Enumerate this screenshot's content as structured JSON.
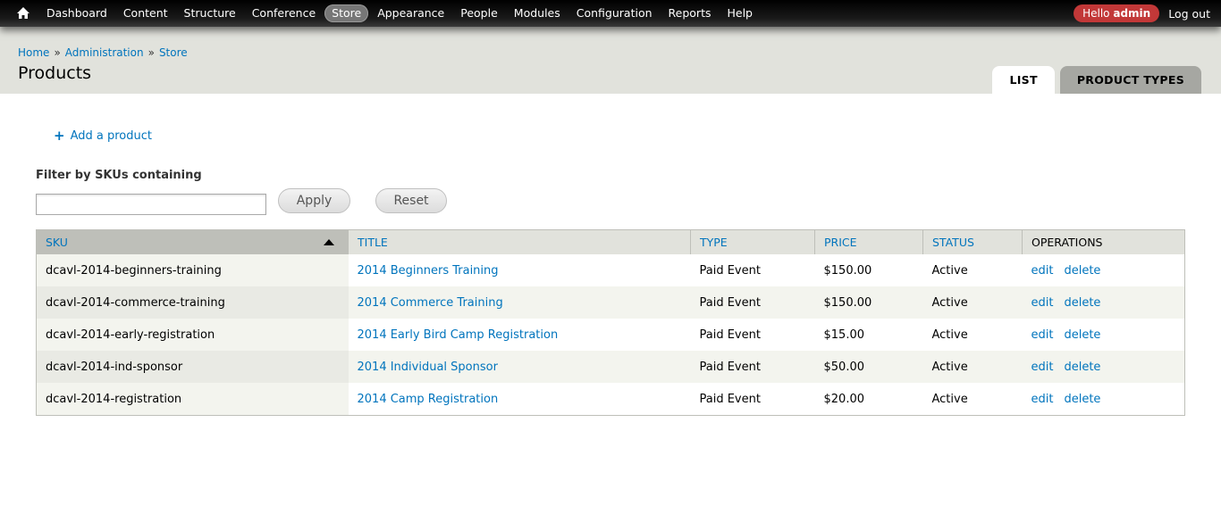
{
  "toolbar": {
    "menu": [
      "Dashboard",
      "Content",
      "Structure",
      "Conference",
      "Store",
      "Appearance",
      "People",
      "Modules",
      "Configuration",
      "Reports",
      "Help"
    ],
    "active_item": "Store",
    "hello_prefix": "Hello",
    "username": "admin",
    "logout": "Log out"
  },
  "breadcrumb": [
    "Home",
    "Administration",
    "Store"
  ],
  "breadcrumb_separator": "»",
  "page_title": "Products",
  "tabs": [
    {
      "label": "LIST",
      "active": true
    },
    {
      "label": "PRODUCT TYPES",
      "active": false
    }
  ],
  "actions": {
    "add_product_icon": "+",
    "add_product": "Add a product"
  },
  "filter": {
    "label": "Filter by SKUs containing",
    "value": "",
    "apply_label": "Apply",
    "reset_label": "Reset"
  },
  "table": {
    "headers": {
      "sku": "SKU",
      "title": "TITLE",
      "type": "TYPE",
      "price": "PRICE",
      "status": "STATUS",
      "operations": "OPERATIONS"
    },
    "sort_column": "sku",
    "sort_direction": "asc",
    "rows": [
      {
        "sku": "dcavl-2014-beginners-training",
        "title": "2014 Beginners Training",
        "type": "Paid Event",
        "price": "$150.00",
        "status": "Active",
        "edit": "edit",
        "delete": "delete"
      },
      {
        "sku": "dcavl-2014-commerce-training",
        "title": "2014 Commerce Training",
        "type": "Paid Event",
        "price": "$150.00",
        "status": "Active",
        "edit": "edit",
        "delete": "delete"
      },
      {
        "sku": "dcavl-2014-early-registration",
        "title": "2014 Early Bird Camp Registration",
        "type": "Paid Event",
        "price": "$15.00",
        "status": "Active",
        "edit": "edit",
        "delete": "delete"
      },
      {
        "sku": "dcavl-2014-ind-sponsor",
        "title": "2014 Individual Sponsor",
        "type": "Paid Event",
        "price": "$50.00",
        "status": "Active",
        "edit": "edit",
        "delete": "delete"
      },
      {
        "sku": "dcavl-2014-registration",
        "title": "2014 Camp Registration",
        "type": "Paid Event",
        "price": "$20.00",
        "status": "Active",
        "edit": "edit",
        "delete": "delete"
      }
    ]
  },
  "colors": {
    "link": "#0074bd",
    "hello_badge": "#c23838",
    "header_band": "#e1e2dc"
  }
}
